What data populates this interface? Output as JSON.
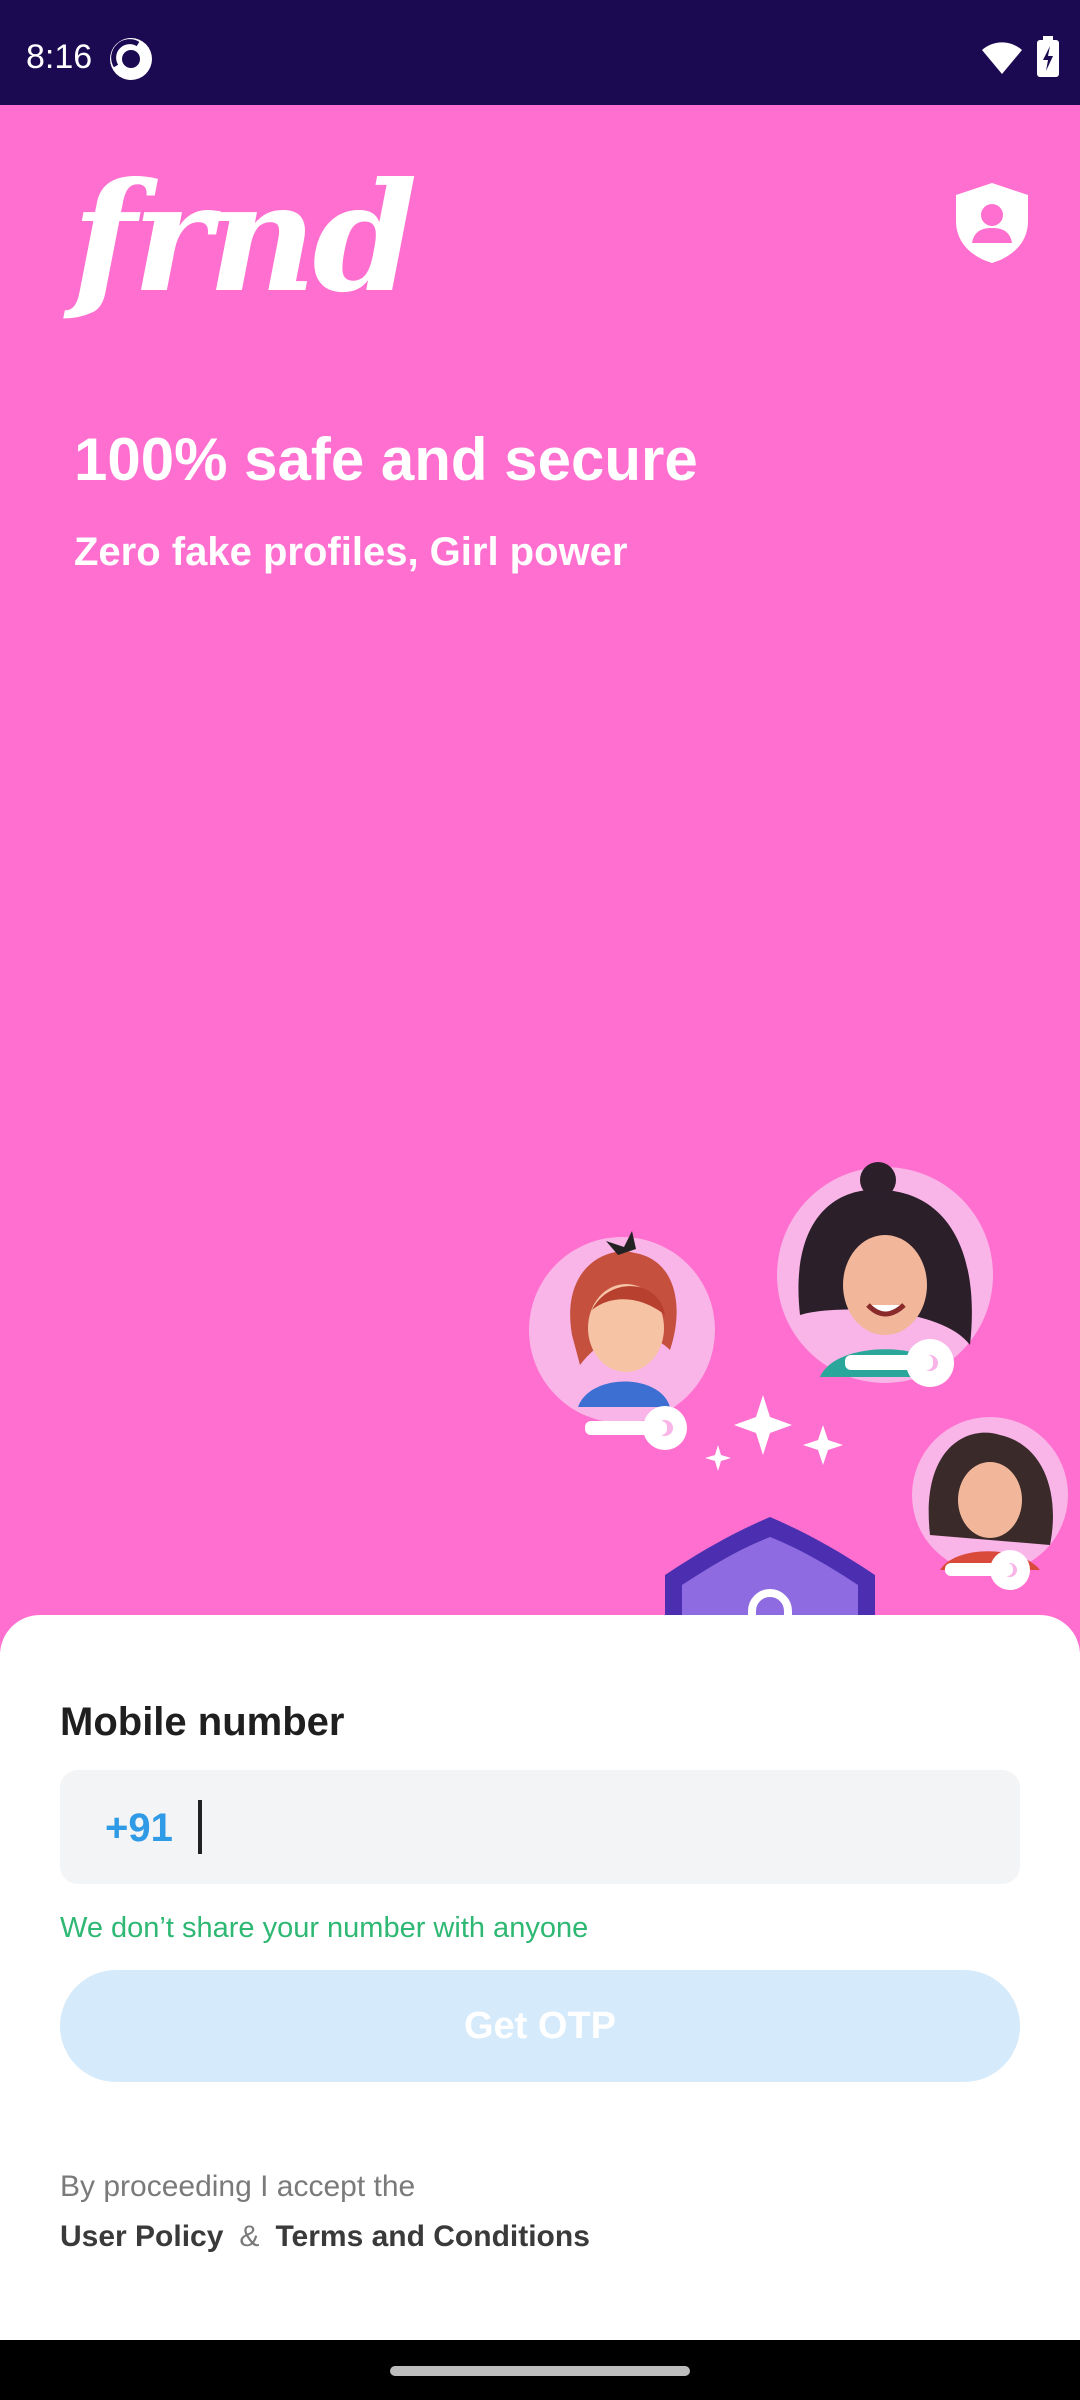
{
  "status_bar": {
    "time": "8:16",
    "icons": [
      "app-notification-icon",
      "wifi-icon",
      "battery-charging-icon"
    ]
  },
  "hero": {
    "logo_text": "frnd",
    "title": "100% safe and secure",
    "subtitle": "Zero fake profiles, Girl power",
    "safety_icon": "shield-user-icon",
    "pager": {
      "count": 3,
      "active_index": 2
    }
  },
  "login": {
    "label": "Mobile number",
    "country_code": "+91",
    "phone_value": "",
    "privacy_note": "We don’t share your number with anyone",
    "otp_button": "Get OTP",
    "consent_text": "By proceeding I accept the",
    "user_policy": "User Policy",
    "ampersand": "&",
    "terms": "Terms and Conditions"
  },
  "colors": {
    "hero_background": "#FF6FCF",
    "status_bar": "#1B0A52",
    "country_code": "#2F9AE6",
    "privacy_note": "#2EB873",
    "otp_button_disabled": "#D5EAFB"
  }
}
